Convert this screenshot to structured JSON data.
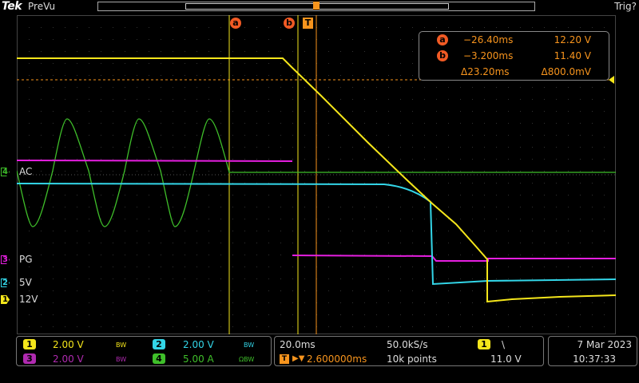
{
  "topbar": {
    "brand": "Tek",
    "mode": "PreVu",
    "trigger_status": "Trig?"
  },
  "channels": {
    "ch4_marker": "4",
    "ch4_label": "AC",
    "ch3_marker": "3",
    "ch3_label": "PG",
    "ch2_marker": "2",
    "ch2_label": "5V",
    "ch1_marker": "1",
    "ch1_label": "12V"
  },
  "cursors": {
    "a_tag": "a",
    "b_tag": "b",
    "trigger_tag": "T",
    "readout": {
      "a_time": "−26.40ms",
      "a_value": "12.20 V",
      "b_time": "−3.200ms",
      "b_value": "11.40 V",
      "delta_time": "Δ23.20ms",
      "delta_value": "Δ800.0mV"
    }
  },
  "bottom": {
    "ch1": {
      "badge": "1",
      "scale": "2.00 V",
      "bw": "BW"
    },
    "ch2": {
      "badge": "2",
      "scale": "2.00 V",
      "bw": "BW"
    },
    "ch3": {
      "badge": "3",
      "scale": "2.00 V",
      "bw": "BW"
    },
    "ch4": {
      "badge": "4",
      "scale": "5.00 A",
      "bw": "ΩBW"
    },
    "timebase": {
      "horizontal_scale": "20.0ms",
      "sample_rate": "50.0kS/s",
      "trigger_pos": "2.600000ms",
      "record_length": "10k points"
    },
    "trigger": {
      "badge": "1",
      "slope": "\\",
      "level": "11.0 V"
    },
    "datetime": {
      "date": "7 Mar  2023",
      "time": "10:37:33"
    }
  },
  "colors": {
    "ch1": "#f5e61b",
    "ch2": "#33d6e8",
    "ch3": "#e61ee0",
    "ch4": "#3fbf2a",
    "cursor": "#f7941d"
  }
}
